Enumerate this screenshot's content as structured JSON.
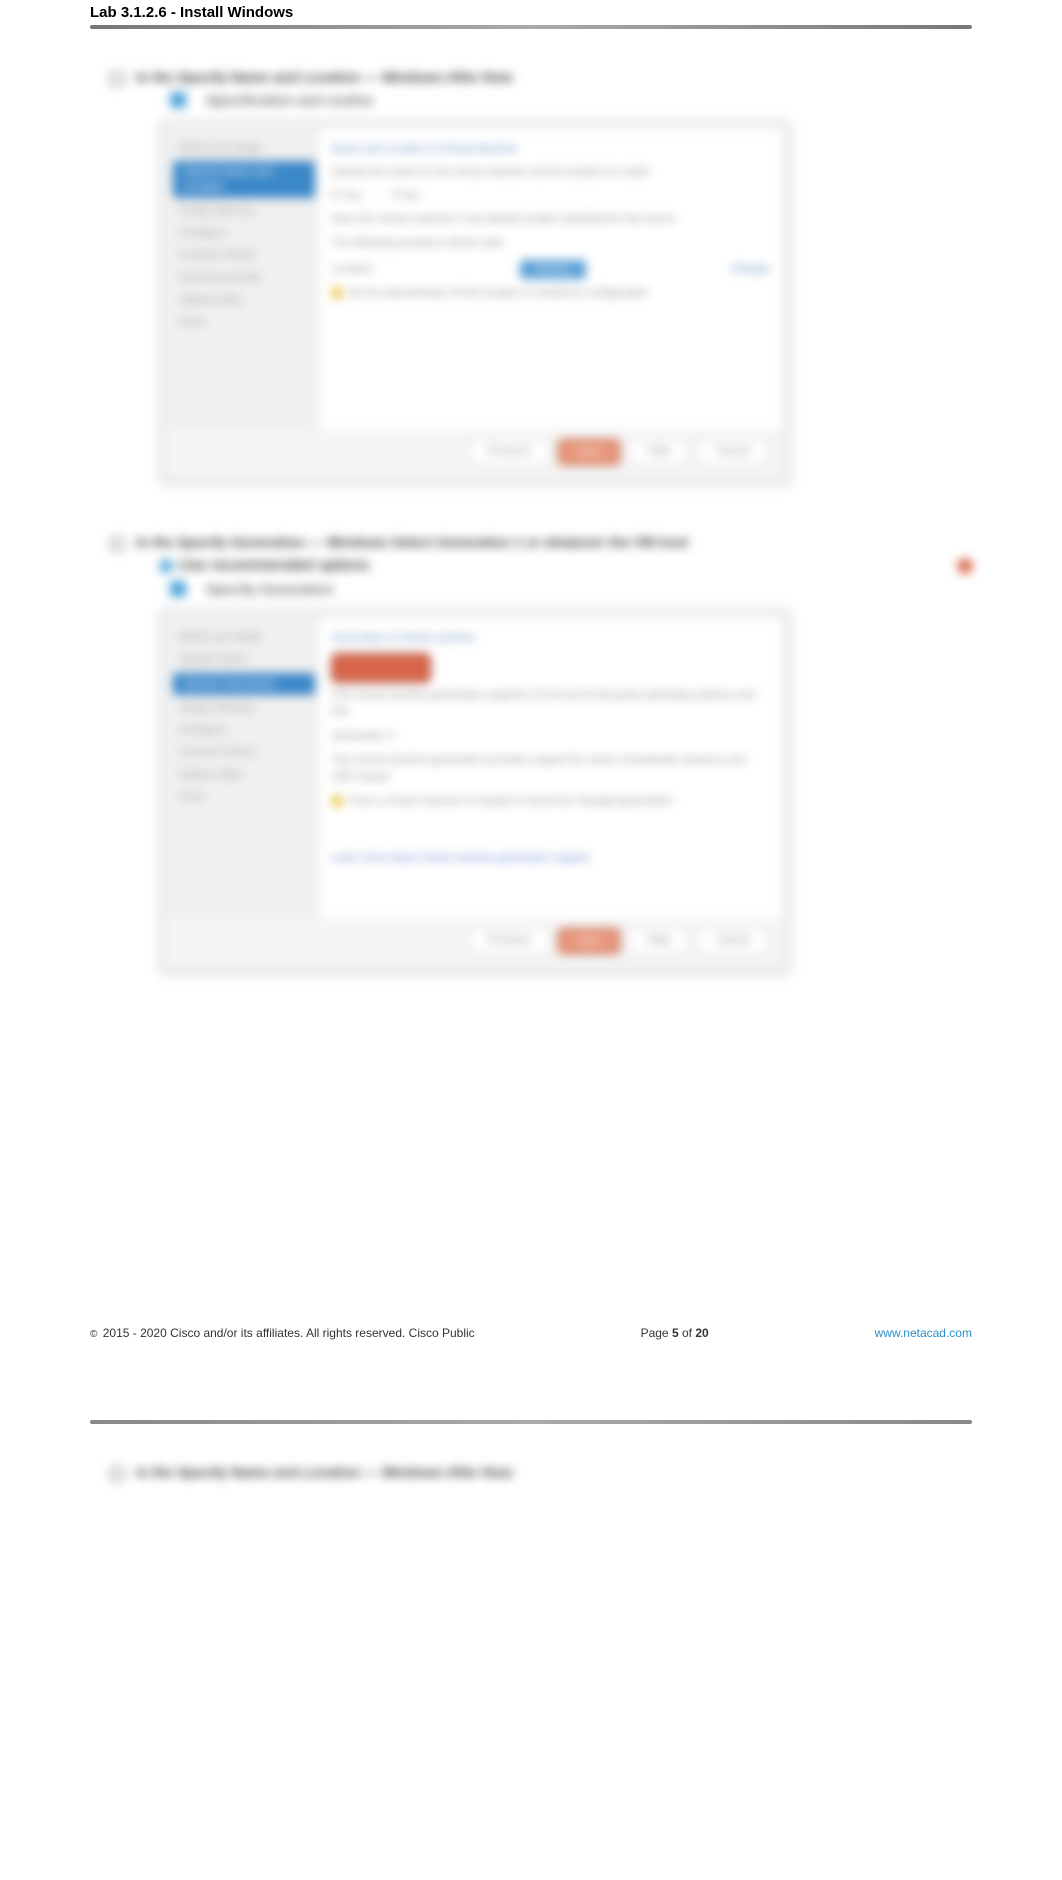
{
  "header": {
    "title": "Lab 3.1.2.6 - Install Windows"
  },
  "step1": {
    "label": "In the Specify Name and Location — Windows After Now",
    "sub": "Specification and routine"
  },
  "wizard1": {
    "sidebar": {
      "item1": "Before you begin",
      "item2": "Specify Name and Location",
      "item3": "Assign Memory",
      "item4": "Configure",
      "item5": "Connect Virtual",
      "item6": "Virtual Hard Disk",
      "item7": "Options After",
      "item8": "Done"
    },
    "main": {
      "title": "Name and Location of Virtual Machine",
      "para1": "Specify the name for the virtual machine and its location to create",
      "radio1": "Yes",
      "radio2": "No",
      "para2": "Store the virtual machine in the default location specified for this server",
      "para3": "The following locations will be used",
      "location_label": "Location:",
      "browse": "Browse",
      "change": "Change",
      "warning": "Be the administrator of this location to install the configuration"
    },
    "footer": {
      "previous": "Previous",
      "next": "Next",
      "help": "Help",
      "cancel": "Cancel"
    }
  },
  "step2": {
    "label": "In the Specify Generation — Windows Select Generation 1 or whatever the VM host",
    "checkbox": "Use recommended options",
    "sub": "Specify Generation"
  },
  "wizard2": {
    "sidebar": {
      "item1": "Before you begin",
      "item2": "Specify Name",
      "item3": "Specify Generation",
      "item4": "Assign Memory",
      "item5": "Configure",
      "item6": "Connect Virtual",
      "item7": "Options After",
      "item8": "Done"
    },
    "main": {
      "title": "Generation of virtual machine",
      "callout": "Generation 1",
      "para1": "This virtual machine generation supports 32-bit and 64-bit guest operating systems and has",
      "para2": "Generation 2",
      "para3": "This virtual machine generation provides support for newer virtualization features and UEFI-based",
      "warning": "Once a virtual machine is created it cannot be changed generation.",
      "link": "Learn more about virtual machine generation support"
    },
    "footer": {
      "previous": "Previous",
      "next": "Next",
      "help": "Help",
      "cancel": "Cancel"
    }
  },
  "footer": {
    "copyright": "2015 - 2020 Cisco and/or its affiliates. All rights reserved. Cisco Public",
    "page_label": "Page",
    "page_current": "5",
    "page_of": "of",
    "page_total": "20",
    "link": "www.netacad.com"
  },
  "step3": {
    "label": "In the Specify Name and Location — Windows After Now"
  }
}
